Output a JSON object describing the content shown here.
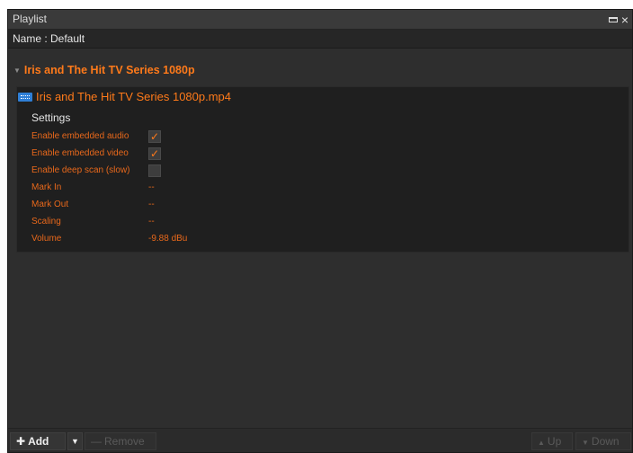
{
  "window": {
    "title": "Playlist"
  },
  "playlist": {
    "name_label": "Name : Default"
  },
  "group": {
    "title": "Iris and The Hit TV Series 1080p"
  },
  "clip": {
    "file_name": "Iris and The Hit TV Series 1080p.mp4",
    "settings_label": "Settings",
    "rows": {
      "audio": {
        "label": "Enable embedded audio",
        "checked": true,
        "mark": "✓"
      },
      "video": {
        "label": "Enable embedded video",
        "checked": true,
        "mark": "✓"
      },
      "deep_scan": {
        "label": "Enable deep scan (slow)",
        "checked": false,
        "mark": ""
      },
      "mark_in": {
        "label": "Mark In",
        "value": "--"
      },
      "mark_out": {
        "label": "Mark Out",
        "value": "--"
      },
      "scaling": {
        "label": "Scaling",
        "value": "--"
      },
      "volume": {
        "label": "Volume",
        "value": "-9.88 dBu"
      }
    }
  },
  "toolbar": {
    "add_label": "Add",
    "remove_label": "Remove",
    "up_label": "Up",
    "down_label": "Down"
  },
  "colors": {
    "accent": "#ff7a1a",
    "label": "#e8681b",
    "panel": "#2e2e2e",
    "clip_bg": "#1f1f1f"
  },
  "icons": [
    "maximize-icon",
    "close-icon",
    "collapse-triangle-icon",
    "video-file-icon",
    "plus-icon",
    "dropdown-arrow-icon",
    "minus-icon",
    "up-arrow-icon",
    "down-arrow-icon"
  ]
}
